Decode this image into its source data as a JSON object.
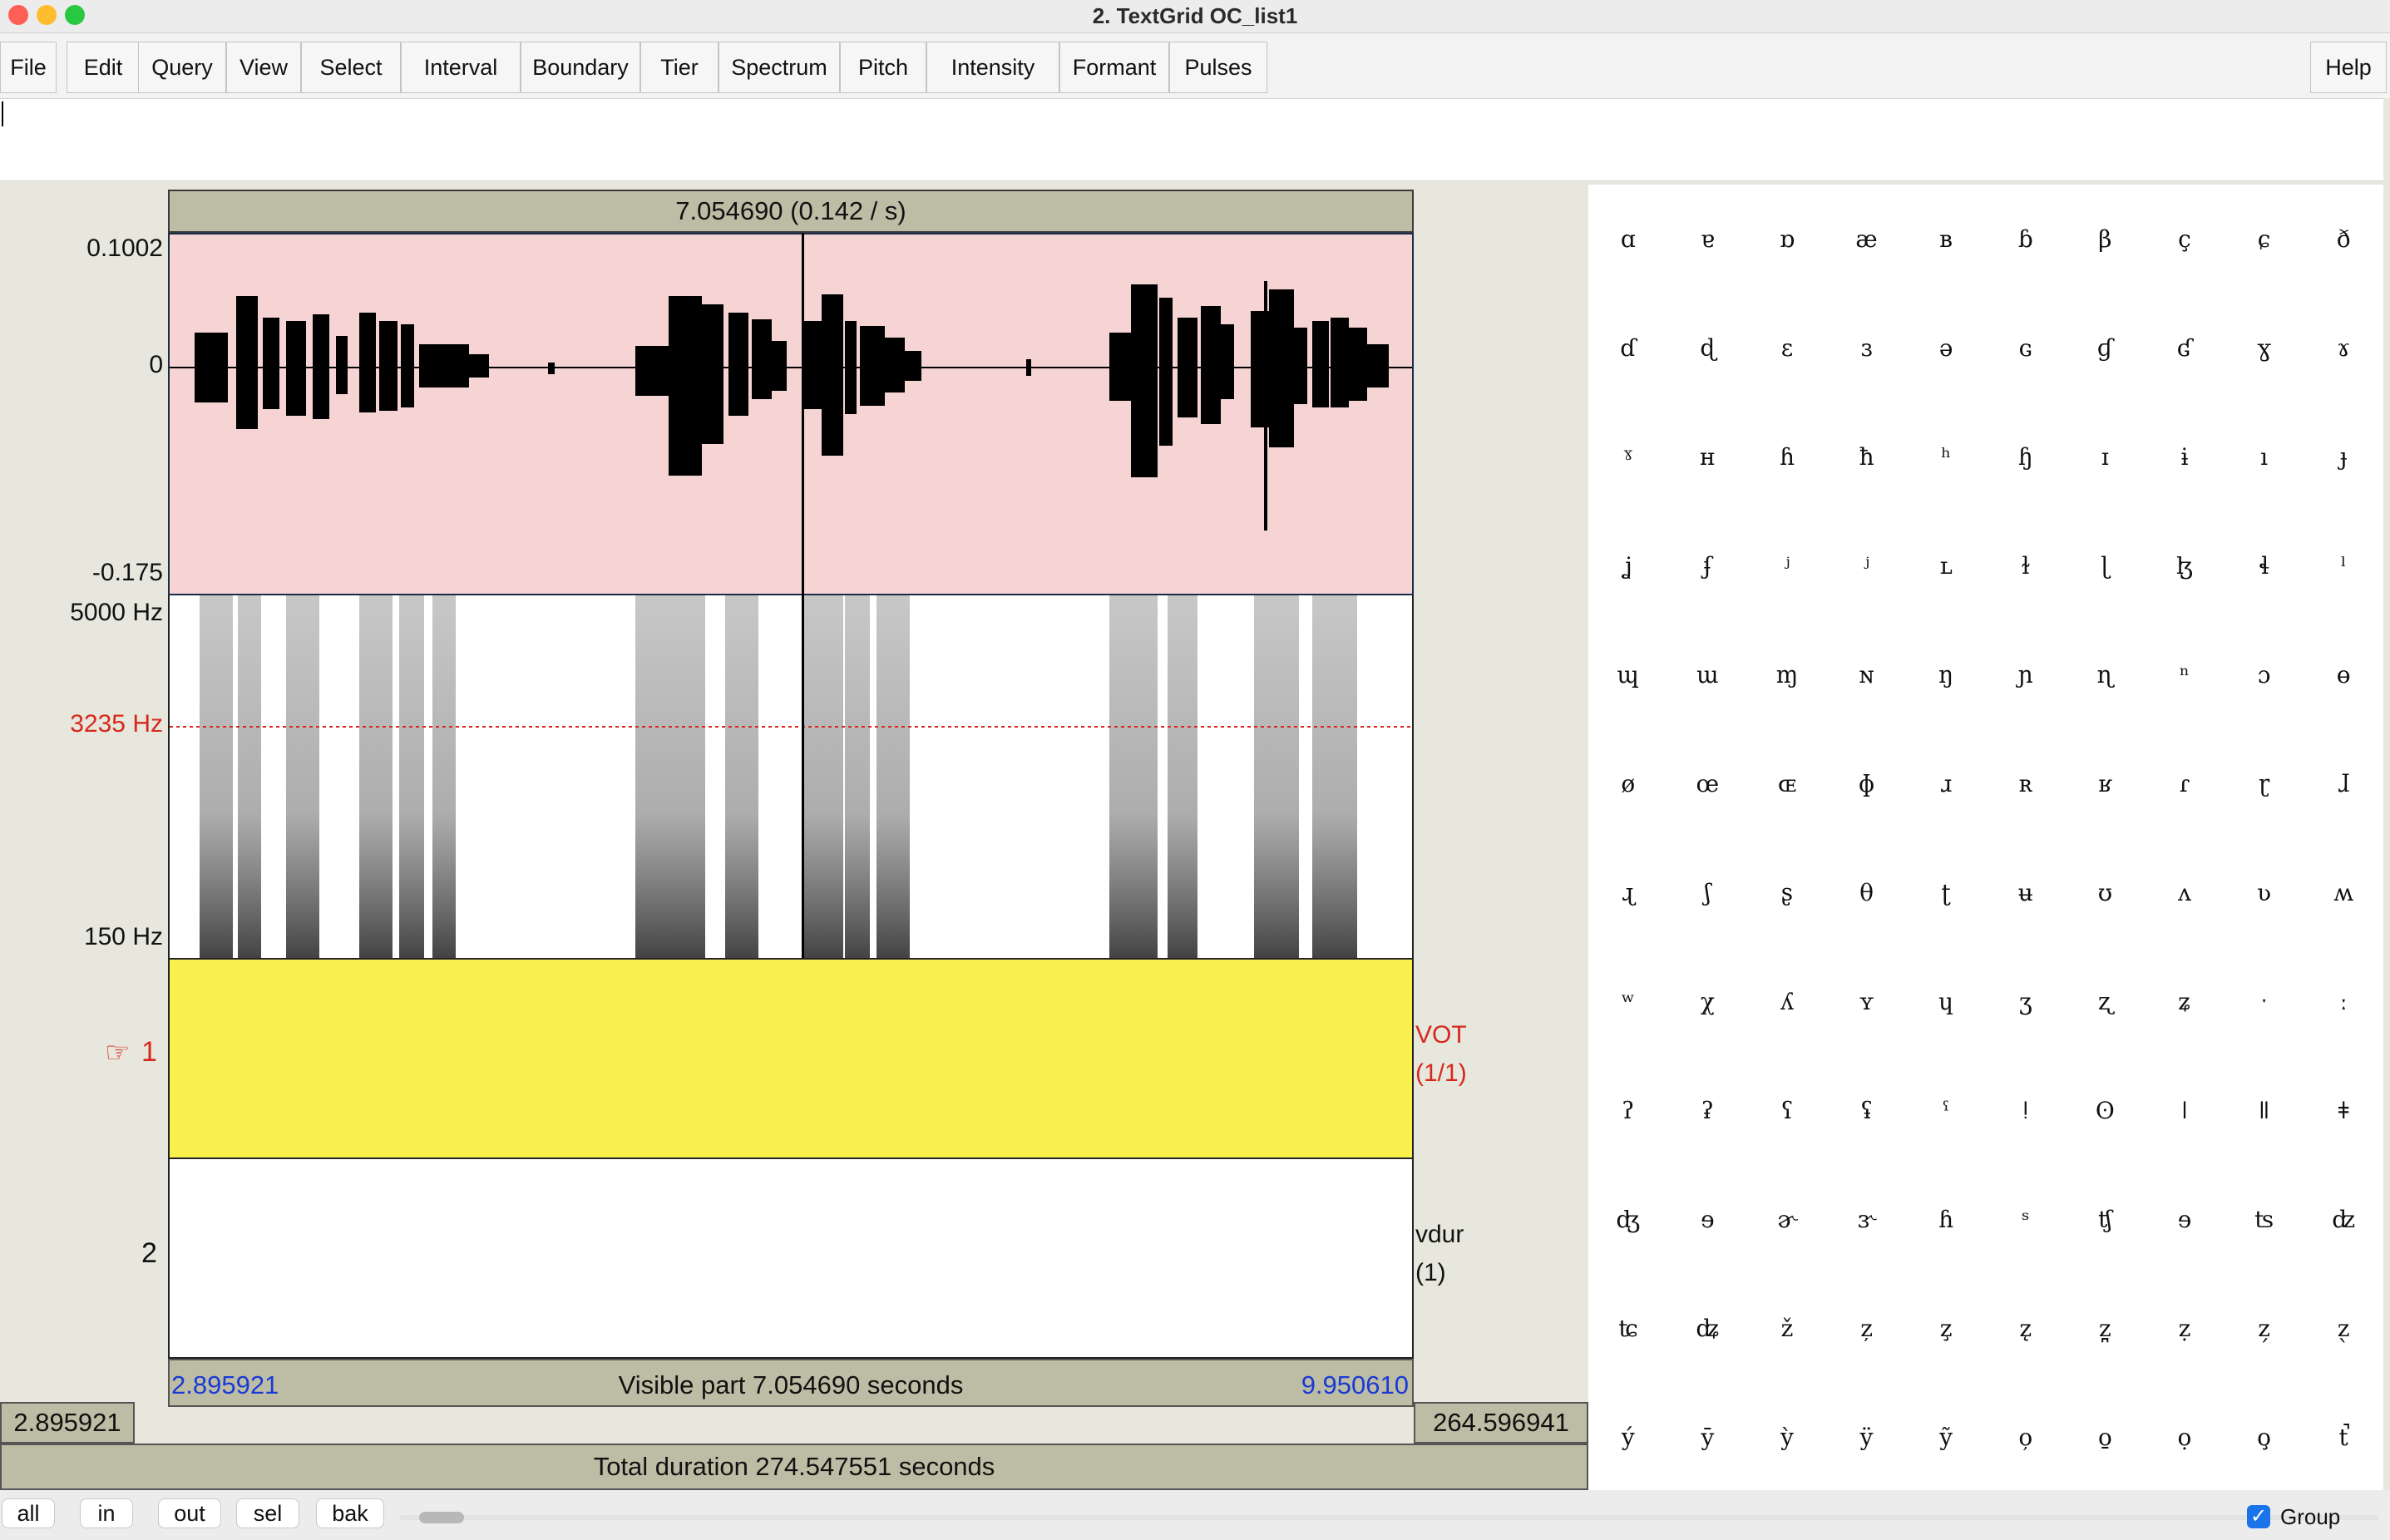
{
  "window": {
    "title": "2. TextGrid OC_list1"
  },
  "menu": [
    "File",
    "Edit",
    "Query",
    "View",
    "Select",
    "Interval",
    "Boundary",
    "Tier",
    "Spectrum",
    "Pitch",
    "Intensity",
    "Formant",
    "Pulses"
  ],
  "help_label": "Help",
  "text_field": {
    "value": ""
  },
  "cursor_bar": "7.054690 (0.142 / s)",
  "waveform": {
    "max_label": "0.1002",
    "zero_label": "0",
    "min_label": "-0.175"
  },
  "spectrogram": {
    "top_label": "5000 Hz",
    "cursor_label": "3235 Hz",
    "bottom_label": "150 Hz"
  },
  "tiers": [
    {
      "number": "1",
      "pointer": "☞",
      "name": "VOT",
      "count": "(1/1)"
    },
    {
      "number": "2",
      "name": "vdur",
      "count": "(1)"
    }
  ],
  "visible": {
    "start": "2.895921",
    "label": "Visible part 7.054690 seconds",
    "end": "9.950610"
  },
  "left_time": "2.895921",
  "right_time": "264.596941",
  "total": "Total duration 274.547551 seconds",
  "zoom_buttons": [
    "all",
    "in",
    "out",
    "sel",
    "bak"
  ],
  "group_label": "Group",
  "group_checked": true,
  "ipa_symbols": [
    "ɑ",
    "ɐ",
    "ɒ",
    "æ",
    "ʙ",
    "ɓ",
    "β",
    "ç",
    "ɕ",
    "ð",
    "ɗ",
    "ɖ",
    "ɛ",
    "ɜ",
    "ə",
    "ɢ",
    "ɠ",
    "ʛ",
    "ɣ",
    "ɤ",
    "ˠ",
    "ʜ",
    "ɦ",
    "ħ",
    "ʰ",
    "ɧ",
    "ɪ",
    "ɨ",
    "ı",
    "ɟ",
    "ʝ",
    "ʄ",
    "ʲ",
    "ʲ",
    "ʟ",
    "ɫ",
    "ɭ",
    "ɮ",
    "ɬ",
    "ˡ",
    "ɰ",
    "ɯ",
    "ɱ",
    "ɴ",
    "ŋ",
    "ɲ",
    "ɳ",
    "ⁿ",
    "ɔ",
    "ɵ",
    "ø",
    "œ",
    "ɶ",
    "ɸ",
    "ɹ",
    "ʀ",
    "ʁ",
    "ɾ",
    "ɽ",
    "ɺ",
    "ɻ",
    "ʃ",
    "ʂ",
    "θ",
    "ʈ",
    "ʉ",
    "ʊ",
    "ʌ",
    "ʋ",
    "ʍ",
    "ʷ",
    "χ",
    "ʎ",
    "ʏ",
    "ɥ",
    "ʒ",
    "ʐ",
    "ʑ",
    "ˑ",
    "ː",
    "ʔ",
    "ʡ",
    "ʕ",
    "ʢ",
    "ˤ",
    "ǃ",
    "ʘ",
    "ǀ",
    "ǁ",
    "ǂ",
    "ʤ",
    "ɘ",
    "ɚ",
    "ɝ",
    "ɦ",
    "ˢ",
    "ʧ",
    "ɘ",
    "ʦ",
    "ʣ",
    "ʨ",
    "ʥ",
    "ž",
    "z̦",
    "z̧",
    "z̨",
    "z̪",
    "ẓ",
    "z̗",
    "z̖",
    "ý",
    "ȳ",
    "ỳ",
    "ÿ",
    "ỹ",
    "o̦",
    "o̱",
    "ọ",
    "o̧",
    "t̚"
  ],
  "colors": {
    "waveform_bg": "#f6d4d4",
    "tier_selected": "#f7f04d",
    "info_bar": "#bdbda5",
    "accent_blue": "#1a3ad6",
    "accent_red": "#d8281c"
  }
}
